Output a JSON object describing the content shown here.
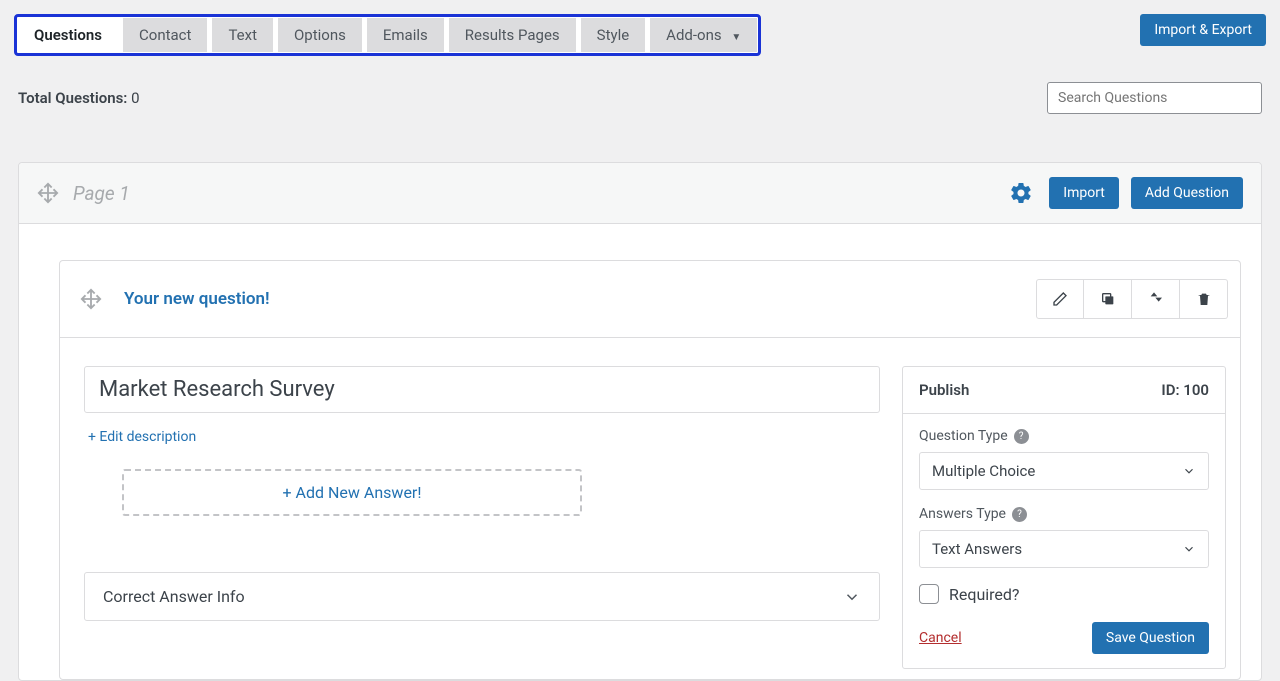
{
  "tabs": {
    "items": [
      "Questions",
      "Contact",
      "Text",
      "Options",
      "Emails",
      "Results Pages",
      "Style",
      "Add-ons"
    ],
    "active_index": 0
  },
  "import_export": "Import & Export",
  "total_questions_label": "Total Questions:",
  "total_questions_value": "0",
  "search_placeholder": "Search Questions",
  "page": {
    "title": "Page 1",
    "import_btn": "Import",
    "add_question_btn": "Add Question"
  },
  "question": {
    "title": "Your new question!",
    "input_value": "Market Research Survey",
    "edit_description": "+ Edit description",
    "add_answer": "+ Add New Answer!",
    "correct_answer_info": "Correct Answer Info"
  },
  "publish": {
    "title": "Publish",
    "id_label": "ID: 100",
    "question_type_label": "Question Type",
    "question_type_value": "Multiple Choice",
    "answers_type_label": "Answers Type",
    "answers_type_value": "Text Answers",
    "required_label": "Required?",
    "cancel": "Cancel",
    "save": "Save Question"
  }
}
